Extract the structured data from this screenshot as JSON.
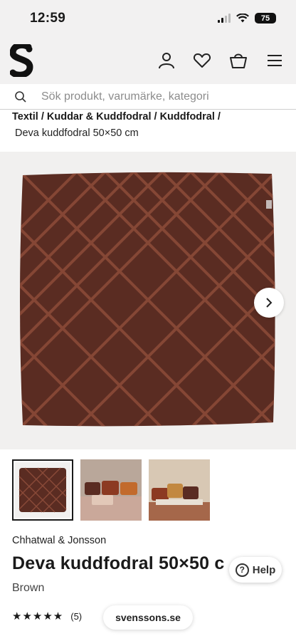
{
  "status_bar": {
    "time": "12:59",
    "battery": "75"
  },
  "search": {
    "placeholder": "Sök produkt, varumärke, kategori"
  },
  "breadcrumb": {
    "path": "Textil / Kuddar & Kuddfodral / Kuddfodral /",
    "current": "Deva kuddfodral 50×50 cm"
  },
  "product": {
    "brand": "Chhatwal & Jonsson",
    "title": "Deva kuddfodral 50×50 c",
    "color": "Brown",
    "stars": "★★★★★",
    "rating_count": "(5)"
  },
  "help": {
    "label": "Help"
  },
  "browser": {
    "url": "svenssons.se"
  },
  "colors": {
    "cushion": "#5a2c22",
    "background": "#f2f1f1"
  }
}
